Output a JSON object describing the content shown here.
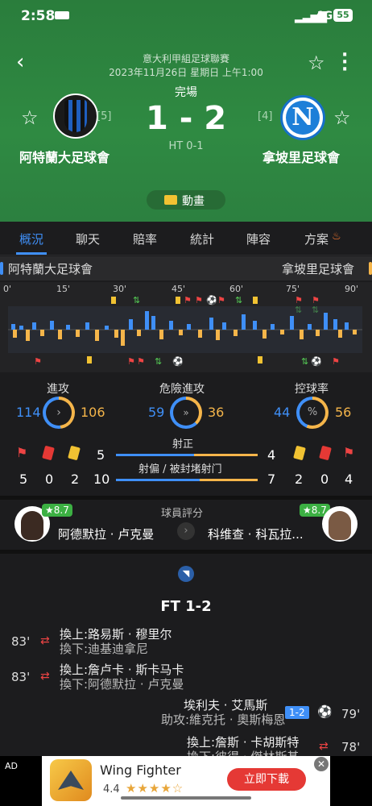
{
  "status_bar": {
    "time": "2:58",
    "network": "4G",
    "battery": "55"
  },
  "match": {
    "league": "意大利甲組足球聯賽",
    "datetime": "2023年11月26日 星期日 上午1:00",
    "status": "完場",
    "score": "1 - 2",
    "ht": "HT 0-1",
    "home": {
      "name": "阿特蘭大足球會",
      "rank": "[5]"
    },
    "away": {
      "name": "拿坡里足球會",
      "rank": "[4]"
    },
    "animation_label": "動畫"
  },
  "tabs": [
    "概況",
    "聊天",
    "賠率",
    "統計",
    "陣容",
    "方案"
  ],
  "team_row": {
    "home": "阿特蘭大足球會",
    "away": "拿坡里足球會"
  },
  "timeline": {
    "ticks": [
      "0'",
      "15'",
      "30'",
      "45'",
      "60'",
      "75'",
      "90'"
    ]
  },
  "stats": {
    "attack": {
      "label": "進攻",
      "home": "114",
      "away": "106",
      "home_pct": 52
    },
    "danger": {
      "label": "危險進攻",
      "home": "59",
      "away": "36",
      "home_pct": 62
    },
    "possession": {
      "label": "控球率",
      "home": "44",
      "away": "56",
      "home_pct": 44
    },
    "shots_on": {
      "label": "射正",
      "home": "5",
      "away": "4"
    },
    "shots_off": {
      "label": "射偏 / 被封堵射门",
      "home": "10",
      "away": "7"
    },
    "home_cards": {
      "corners": "5",
      "red": "0",
      "yellow": "2"
    },
    "away_cards": {
      "yellow": "2",
      "red": "0",
      "corners": "4"
    }
  },
  "rating": {
    "label": "球員評分",
    "home_player": {
      "name": "阿德默拉 · 卢克曼",
      "score": "★8.7"
    },
    "away_player": {
      "name": "科维查 · 科瓦拉...",
      "score": "★8.7"
    }
  },
  "events_title": "FT 1-2",
  "events": [
    {
      "minute": "83'",
      "in": "換上:路易斯 · 穆里尔",
      "out": "換下:迪基迪拿尼"
    },
    {
      "minute": "83'",
      "in": "換上:詹卢卡 · 斯卡马卡",
      "out": "換下:阿德默拉 · 卢克曼"
    },
    {
      "minute": "79'",
      "scorer": "埃利夫 · 艾馬斯",
      "assist": "助攻:維克托 · 奧斯梅恩",
      "score": "1-2"
    },
    {
      "minute": "78'",
      "in": "換上:詹斯 · 卡胡斯特",
      "out": "換下:彼得 · 傑林斯基"
    }
  ],
  "ad": {
    "tag": "AD",
    "title": "Wing Fighter",
    "rating": "4.4",
    "cta": "立即下載"
  },
  "colors": {
    "home": "#3f8ff7",
    "away": "#f5b54a",
    "green": "#2f8a42"
  }
}
